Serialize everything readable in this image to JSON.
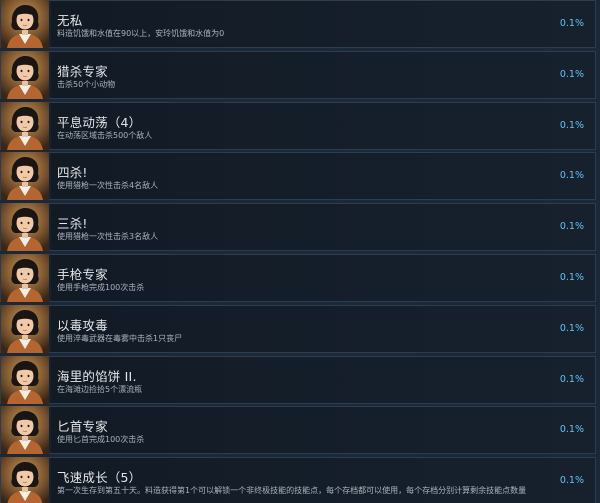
{
  "achievements": [
    {
      "title": "无私",
      "description": "料造饥饿和水值在90以上，安玲饥饿和水值为0",
      "percent": "0.1%",
      "icon": "survivor-portrait-icon"
    },
    {
      "title": "猎杀专家",
      "description": "击杀50个小动物",
      "percent": "0.1%",
      "icon": "survivor-portrait-icon"
    },
    {
      "title": "平息动荡（4）",
      "description": "在动荡区域击杀500个敌人",
      "percent": "0.1%",
      "icon": "survivor-portrait-icon"
    },
    {
      "title": "四杀!",
      "description": "使用猎枪一次性击杀4名敌人",
      "percent": "0.1%",
      "icon": "survivor-portrait-icon"
    },
    {
      "title": "三杀!",
      "description": "使用猎枪一次性击杀3名敌人",
      "percent": "0.1%",
      "icon": "survivor-portrait-icon"
    },
    {
      "title": "手枪专家",
      "description": "使用手枪完成100次击杀",
      "percent": "0.1%",
      "icon": "survivor-portrait-icon"
    },
    {
      "title": "以毒攻毒",
      "description": "使用淬毒武器在毒雾中击杀1只丧尸",
      "percent": "0.1%",
      "icon": "survivor-portrait-icon"
    },
    {
      "title": "海里的馅饼 II.",
      "description": "在海滩边捡拾5个漂流瓶",
      "percent": "0.1%",
      "icon": "survivor-portrait-icon"
    },
    {
      "title": "匕首专家",
      "description": "使用匕首完成100次击杀",
      "percent": "0.1%",
      "icon": "survivor-portrait-icon"
    },
    {
      "title": "飞速成长（5）",
      "description": "第一次生存到第五十天。料造获得第1个可以解锁一个非终极技能的技能点，每个存档都可以使用，每个存档分别计算剩余技能点数量",
      "percent": "0.1%",
      "icon": "survivor-portrait-icon"
    }
  ]
}
